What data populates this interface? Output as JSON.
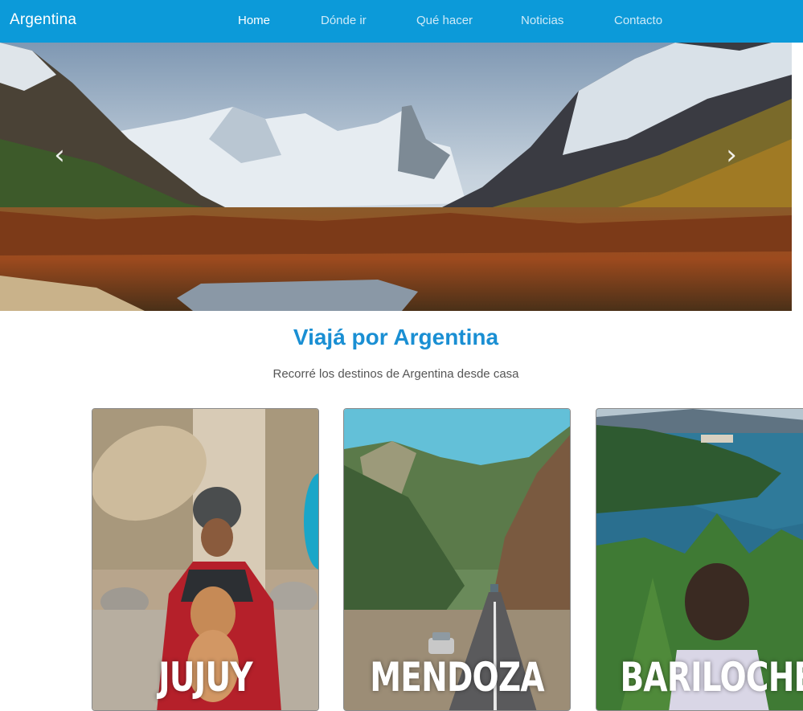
{
  "navbar": {
    "brand": "Argentina",
    "links": [
      {
        "label": "Home",
        "active": true
      },
      {
        "label": "Dónde ir",
        "active": false
      },
      {
        "label": "Qué hacer",
        "active": false
      },
      {
        "label": "Noticias",
        "active": false
      },
      {
        "label": "Contacto",
        "active": false
      }
    ],
    "background_color": "#0c9ad9"
  },
  "carousel": {
    "prev_icon": "chevron-left-icon",
    "next_icon": "chevron-right-icon",
    "prev_glyph": "‹",
    "next_glyph": "›"
  },
  "main": {
    "title": "Viajá por Argentina",
    "subtitle": "Recorré los destinos de Argentina desde casa",
    "title_color": "#1a8fd3"
  },
  "cards": [
    {
      "label": "JUJUY"
    },
    {
      "label": "MENDOZA"
    },
    {
      "label": "BARILOCHE"
    }
  ]
}
